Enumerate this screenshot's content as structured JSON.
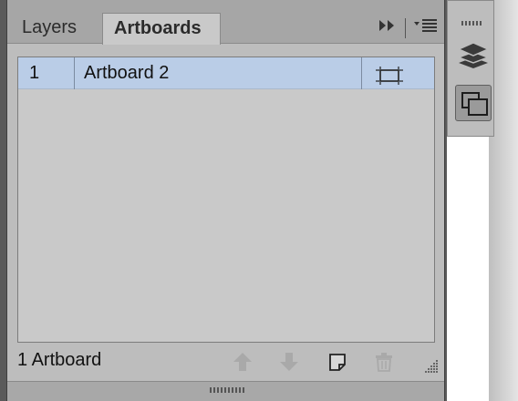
{
  "panel": {
    "tabs": [
      {
        "label": "Layers",
        "active": false
      },
      {
        "label": "Artboards",
        "active": true
      }
    ],
    "controls": {
      "collapse_icon": "double-chevron-right-icon",
      "menu_icon": "panel-menu-icon"
    }
  },
  "artboards": {
    "rows": [
      {
        "index": "1",
        "name": "Artboard 2",
        "selected": true,
        "icon": "artboard-frame-icon"
      }
    ]
  },
  "footer": {
    "count_label": "1 Artboard",
    "buttons": [
      {
        "name": "move-up",
        "icon": "arrow-up-icon",
        "enabled": false
      },
      {
        "name": "move-down",
        "icon": "arrow-down-icon",
        "enabled": false
      },
      {
        "name": "new-artboard",
        "icon": "new-artboard-icon",
        "enabled": true
      },
      {
        "name": "delete-artboard",
        "icon": "trash-icon",
        "enabled": false
      }
    ]
  },
  "dock": {
    "buttons": [
      {
        "name": "layers",
        "icon": "layers-stack-icon",
        "active": false
      },
      {
        "name": "artboards",
        "icon": "artboards-icon",
        "active": true
      }
    ]
  },
  "colors": {
    "panel_bg": "#bdbdbd",
    "list_bg": "#c9c9c9",
    "selected_row": "#bacde7",
    "tabbar_bg": "#a6a6a6"
  }
}
